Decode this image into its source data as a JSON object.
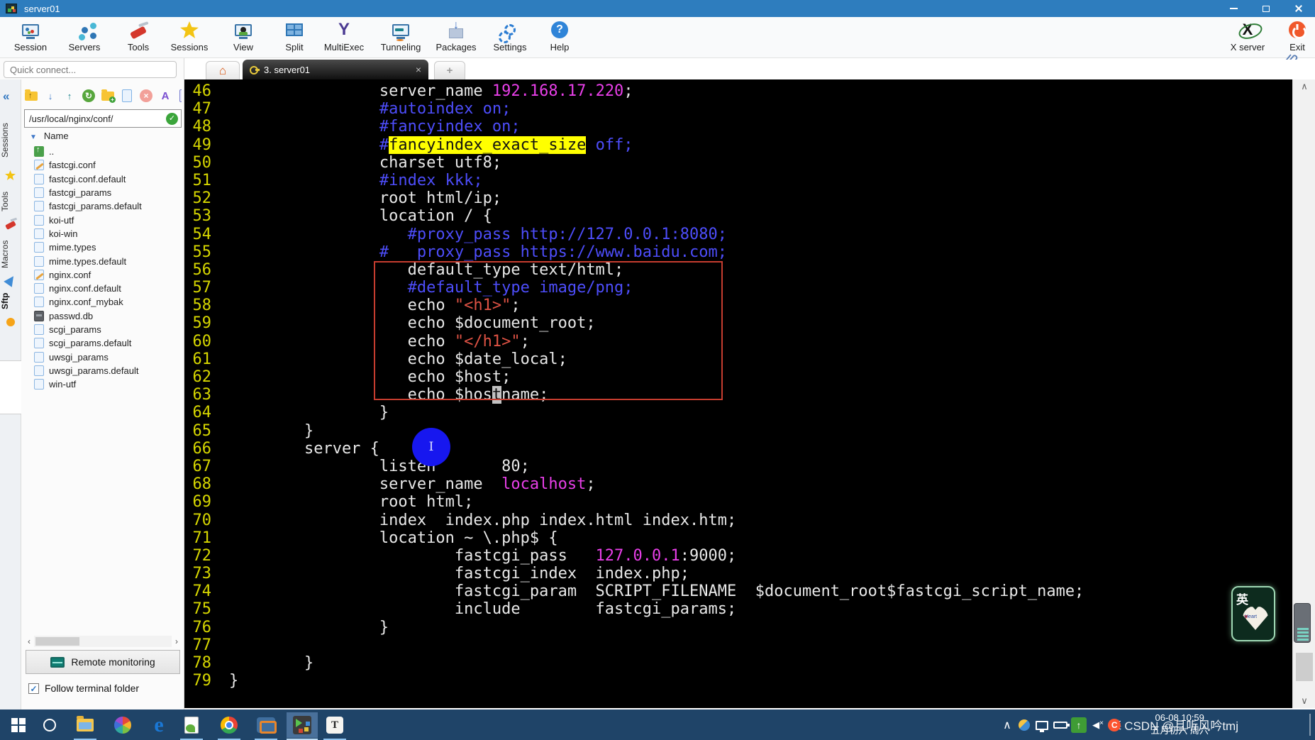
{
  "window": {
    "title": "server01"
  },
  "toolbar": {
    "items": [
      {
        "id": "session",
        "label": "Session"
      },
      {
        "id": "servers",
        "label": "Servers"
      },
      {
        "id": "tools",
        "label": "Tools"
      },
      {
        "id": "sessions",
        "label": "Sessions"
      },
      {
        "id": "view",
        "label": "View"
      },
      {
        "id": "split",
        "label": "Split"
      },
      {
        "id": "multiexec",
        "label": "MultiExec"
      },
      {
        "id": "tunneling",
        "label": "Tunneling"
      },
      {
        "id": "packages",
        "label": "Packages"
      },
      {
        "id": "settings",
        "label": "Settings"
      },
      {
        "id": "help",
        "label": "Help"
      }
    ],
    "right_items": [
      {
        "id": "xserver",
        "label": "X server"
      },
      {
        "id": "exit",
        "label": "Exit"
      }
    ]
  },
  "quick_connect": {
    "placeholder": "Quick connect..."
  },
  "side_strip": {
    "tabs": [
      {
        "label": "Sessions"
      },
      {
        "label": "Tools"
      },
      {
        "label": "Macros"
      },
      {
        "label": "Sftp",
        "active": true
      }
    ]
  },
  "sftp": {
    "path": "/usr/local/nginx/conf/",
    "name_header": "Name",
    "remote_monitoring": "Remote monitoring",
    "follow_terminal_folder": "Follow terminal folder",
    "follow_checked": true,
    "files": [
      {
        "name": "..",
        "icon": "up"
      },
      {
        "name": "fastcgi.conf",
        "icon": "conf"
      },
      {
        "name": "fastcgi.conf.default",
        "icon": "file"
      },
      {
        "name": "fastcgi_params",
        "icon": "file"
      },
      {
        "name": "fastcgi_params.default",
        "icon": "file"
      },
      {
        "name": "koi-utf",
        "icon": "file"
      },
      {
        "name": "koi-win",
        "icon": "file"
      },
      {
        "name": "mime.types",
        "icon": "file"
      },
      {
        "name": "mime.types.default",
        "icon": "file"
      },
      {
        "name": "nginx.conf",
        "icon": "conf"
      },
      {
        "name": "nginx.conf.default",
        "icon": "file"
      },
      {
        "name": "nginx.conf_mybak",
        "icon": "file"
      },
      {
        "name": "passwd.db",
        "icon": "db"
      },
      {
        "name": "scgi_params",
        "icon": "file"
      },
      {
        "name": "scgi_params.default",
        "icon": "file"
      },
      {
        "name": "uwsgi_params",
        "icon": "file"
      },
      {
        "name": "uwsgi_params.default",
        "icon": "file"
      },
      {
        "name": "win-utf",
        "icon": "file"
      }
    ]
  },
  "tab_bar": {
    "session_tab": "3. server01"
  },
  "terminal": {
    "lines": [
      {
        "n": "46",
        "s": [
          [
            "w",
            "                server_name "
          ],
          [
            "m",
            "192.168.17.220"
          ],
          [
            "w",
            ";"
          ]
        ]
      },
      {
        "n": "47",
        "s": [
          [
            "b",
            "                #autoindex on;"
          ]
        ]
      },
      {
        "n": "48",
        "s": [
          [
            "b",
            "                #fancyindex on;"
          ]
        ]
      },
      {
        "n": "49",
        "s": [
          [
            "b",
            "                #"
          ],
          [
            "h",
            "fancyindex_exact_size"
          ],
          [
            "b",
            " off;"
          ]
        ]
      },
      {
        "n": "50",
        "s": [
          [
            "w",
            "                charset utf8;"
          ]
        ]
      },
      {
        "n": "51",
        "s": [
          [
            "b",
            "                #index kkk;"
          ]
        ]
      },
      {
        "n": "52",
        "s": [
          [
            "w",
            "                root html/ip;"
          ]
        ]
      },
      {
        "n": "53",
        "s": [
          [
            "w",
            "                location / {"
          ]
        ]
      },
      {
        "n": "54",
        "s": [
          [
            "b",
            "                   #proxy_pass http://127.0.0.1:8080;"
          ]
        ]
      },
      {
        "n": "55",
        "s": [
          [
            "b",
            "                #   proxy_pass https://www.baidu.com;"
          ]
        ]
      },
      {
        "n": "56",
        "s": [
          [
            "w",
            "                   default_type text/html;"
          ]
        ]
      },
      {
        "n": "57",
        "s": [
          [
            "b",
            "                   #default_type image/png;"
          ]
        ]
      },
      {
        "n": "58",
        "s": [
          [
            "w",
            "                   echo "
          ],
          [
            "r",
            "\"<h1>\""
          ],
          [
            "w",
            ";"
          ]
        ]
      },
      {
        "n": "59",
        "s": [
          [
            "w",
            "                   echo $document_root;"
          ]
        ]
      },
      {
        "n": "60",
        "s": [
          [
            "w",
            "                   echo "
          ],
          [
            "r",
            "\"</h1>\""
          ],
          [
            "w",
            ";"
          ]
        ]
      },
      {
        "n": "61",
        "s": [
          [
            "w",
            "                   echo $date_local;"
          ]
        ]
      },
      {
        "n": "62",
        "s": [
          [
            "w",
            "                   echo $host;"
          ]
        ]
      },
      {
        "n": "63",
        "s": [
          [
            "w",
            "                   echo $hos"
          ],
          [
            "k",
            "t"
          ],
          [
            "w",
            "name;"
          ]
        ]
      },
      {
        "n": "64",
        "s": [
          [
            "w",
            "                }"
          ]
        ]
      },
      {
        "n": "65",
        "s": [
          [
            "w",
            "        }"
          ]
        ]
      },
      {
        "n": "66",
        "s": [
          [
            "w",
            "        server {"
          ]
        ]
      },
      {
        "n": "67",
        "s": [
          [
            "w",
            "                listen       80;"
          ]
        ]
      },
      {
        "n": "68",
        "s": [
          [
            "w",
            "                server_name  "
          ],
          [
            "m",
            "localhost"
          ],
          [
            "w",
            ";"
          ]
        ]
      },
      {
        "n": "69",
        "s": [
          [
            "w",
            "                root html;"
          ]
        ]
      },
      {
        "n": "70",
        "s": [
          [
            "w",
            "                index  index.php index.html index.htm;"
          ]
        ]
      },
      {
        "n": "71",
        "s": [
          [
            "w",
            "                location ~ \\.php$ {"
          ]
        ]
      },
      {
        "n": "72",
        "s": [
          [
            "w",
            "                        fastcgi_pass   "
          ],
          [
            "m",
            "127.0.0.1"
          ],
          [
            "w",
            ":9000;"
          ]
        ]
      },
      {
        "n": "73",
        "s": [
          [
            "w",
            "                        fastcgi_index  index.php;"
          ]
        ]
      },
      {
        "n": "74",
        "s": [
          [
            "w",
            "                        fastcgi_param  SCRIPT_FILENAME  $document_root$fastcgi_script_name;"
          ]
        ]
      },
      {
        "n": "75",
        "s": [
          [
            "w",
            "                        include        fastcgi_params;"
          ]
        ]
      },
      {
        "n": "76",
        "s": [
          [
            "w",
            "                }"
          ]
        ]
      },
      {
        "n": "77",
        "s": []
      },
      {
        "n": "78",
        "s": [
          [
            "w",
            "        }"
          ]
        ]
      },
      {
        "n": "79",
        "s": [
          [
            "w",
            "}"
          ]
        ]
      }
    ]
  },
  "taskbar": {
    "ime": "英",
    "clock_time": "06-08 10:59",
    "clock_date": "五月初六 周六"
  },
  "watermark": {
    "logo_char": "C",
    "text": "CSDN @且听风吟tmj"
  },
  "stickers": {
    "badge_char": "英",
    "heart_text": "Heart"
  },
  "icons": {
    "home": "⌂",
    "close": "×",
    "plus": "+",
    "collapse": "«",
    "sort_caret": "▼",
    "check": "✓",
    "up_arrow": "↑",
    "down_arrow": "↓",
    "refresh": "↻",
    "delete_x": "×",
    "encoding_a": "A",
    "left_arrow": "‹",
    "right_arrow": "›",
    "chevron_up": "∧",
    "chevron_down": "∨",
    "tray_chevron": "∧",
    "speaker": "◀",
    "mute_x": "×",
    "multiexec_y": "Y",
    "edge_e": "e",
    "typora_t": "T",
    "ibeam": "I",
    "folder_up_arrow": "t"
  }
}
